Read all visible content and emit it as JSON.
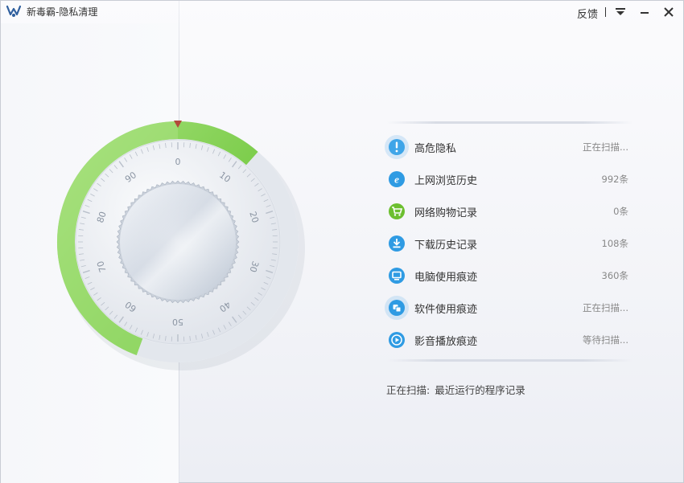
{
  "window": {
    "title": "新毒霸-隐私清理",
    "feedback_label": "反馈",
    "menu_icon": "dropdown-menu-icon",
    "minimize_icon": "minimize-icon",
    "close_icon": "close-icon"
  },
  "dial": {
    "ticks": [
      "0",
      "10",
      "20",
      "30",
      "40",
      "50",
      "60",
      "70",
      "80",
      "90"
    ],
    "progress_fraction": 0.56,
    "accent": "#7dd04a",
    "pointer_color": "#b24a3a"
  },
  "scan_items": [
    {
      "icon": "alert-icon",
      "label": "高危隐私",
      "status": "正在扫描...",
      "color": "#3fa5e8",
      "active": true
    },
    {
      "icon": "ie-browser-icon",
      "label": "上网浏览历史",
      "status": "992条",
      "color": "#2f9be3",
      "active": false
    },
    {
      "icon": "shopping-cart-icon",
      "label": "网络购物记录",
      "status": "0条",
      "color": "#6cbf2f",
      "active": false
    },
    {
      "icon": "download-icon",
      "label": "下载历史记录",
      "status": "108条",
      "color": "#2f9be3",
      "active": false
    },
    {
      "icon": "computer-icon",
      "label": "电脑使用痕迹",
      "status": "360条",
      "color": "#2f9be3",
      "active": false
    },
    {
      "icon": "software-icon",
      "label": "软件使用痕迹",
      "status": "正在扫描...",
      "color": "#2f9be3",
      "active": true
    },
    {
      "icon": "play-icon",
      "label": "影音播放痕迹",
      "status": "等待扫描...",
      "color": "#2f9be3",
      "active": false
    }
  ],
  "status": {
    "prefix": "正在扫描:",
    "detail": "最近运行的程序记录"
  }
}
